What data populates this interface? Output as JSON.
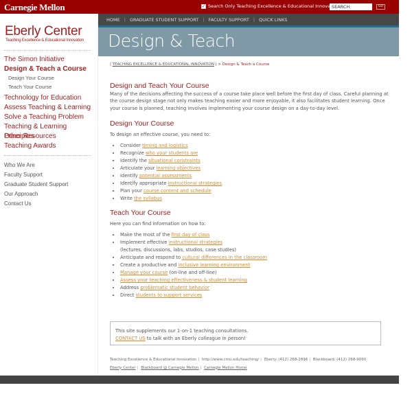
{
  "header": {
    "logo": "Carnegie Mellon",
    "search_only_label": "Search Only Teaching Excellence & Educational Innovation",
    "search_only_checked": true,
    "search_value": "SEARCH",
    "go_label": "GO"
  },
  "navbar": {
    "items": [
      "HOME",
      "GRADUATE STUDENT SUPPORT",
      "FACULTY SUPPORT",
      "QUICK LINKS"
    ]
  },
  "sidebar": {
    "title": "Eberly Center",
    "subtitle": "Teaching Excellence & Educational Innovation",
    "main_items": [
      {
        "label": "The Simon Initiative",
        "active": false
      },
      {
        "label": "Design & Teach a Course",
        "active": true
      },
      {
        "label": "Technology for Education",
        "active": false
      },
      {
        "label": "Assess Teaching & Learning",
        "active": false
      },
      {
        "label": "Solve a Teaching Problem",
        "active": false
      },
      {
        "label": "Teaching & Learning Principles",
        "active": false
      },
      {
        "label": "Other Resources",
        "active": false
      },
      {
        "label": "Teaching Awards",
        "active": false
      }
    ],
    "sub_items": [
      "Design Your Course",
      "Teach Your Course"
    ],
    "secondary_items": [
      "Who We Are",
      "Faculty Support",
      "Graduate Student Support",
      "Our Approach",
      "Contact Us"
    ]
  },
  "banner": {
    "title": "Design & Teach"
  },
  "breadcrumb": {
    "prefix": "| ",
    "link": "TEACHING EXCELLENCE & EDUCATIONAL INNOVATION",
    "suffix": " | > Design & Teach a Course"
  },
  "main": {
    "heading": "Design and Teach Your Course",
    "intro": "Many of the decisions affecting the success of a course take place well before the first day of class. Careful planning at the course design stage not only makes teaching easier and more enjoyable, it also facilitates student learning. Once your course is planned, teaching involves implementing your course design on a day-to-day level.",
    "design": {
      "heading": "Design Your Course",
      "lead": "To design an effective course, you need to:",
      "items": [
        {
          "pre": "Consider ",
          "link": "timing and logistics",
          "post": ""
        },
        {
          "pre": "Recognize ",
          "link": "who your students are",
          "post": ""
        },
        {
          "pre": "Identify the ",
          "link": "situational constraints",
          "post": ""
        },
        {
          "pre": "Articulate your ",
          "link": "learning objectives",
          "post": ""
        },
        {
          "pre": "Identify ",
          "link": "potential assessments",
          "post": ""
        },
        {
          "pre": "Identify appropriate ",
          "link": "instructional strategies",
          "post": ""
        },
        {
          "pre": "Plan your ",
          "link": "course content and schedule",
          "post": ""
        },
        {
          "pre": "Write ",
          "link": "the syllabus",
          "post": ""
        }
      ]
    },
    "teach": {
      "heading": "Teach Your Course",
      "lead": "Here you can find information on how to:",
      "items": [
        {
          "pre": "Make the most of the ",
          "link": "first day of class",
          "post": ""
        },
        {
          "pre": "Implement effective ",
          "link": "instructional strategies",
          "post": "",
          "note": "(lectures, discussions, labs, studios, case studies)"
        },
        {
          "pre": "Anticipate and respond to ",
          "link": "cultural differences in the classroom",
          "post": ""
        },
        {
          "pre": "Create a productive and ",
          "link": "inclusive learning environment",
          "post": ""
        },
        {
          "pre": "",
          "link": "Manage your course",
          "post": " (on-line and off-line)"
        },
        {
          "pre": "",
          "link": "Assess your teaching effectiveness & student learning",
          "post": ""
        },
        {
          "pre": "Address ",
          "link": "problematic student behavior",
          "post": ""
        },
        {
          "pre": "Direct ",
          "link": "students to support services",
          "post": ""
        }
      ]
    }
  },
  "contact_box": {
    "line1": "This site supplements our 1-on-1 teaching consultations.",
    "link": "CONTACT US",
    "line2": " to talk with an Eberly colleague in person!"
  },
  "footer": {
    "line1": [
      "Teaching Excellence & Educational Innovation",
      "http://www.cmu.edu/teaching/",
      "Eberly: (412) 268-2896",
      "Blackboard: (412) 268-9090"
    ],
    "links": [
      "Eberly Center",
      "Blackboard @ Carnegie Mellon",
      "Carnegie Mellon Home"
    ]
  },
  "colors": {
    "brand_red": "#990000",
    "link_orange": "#d98a2e",
    "banner": "#7f9aa6",
    "nav_dark": "#474747"
  }
}
